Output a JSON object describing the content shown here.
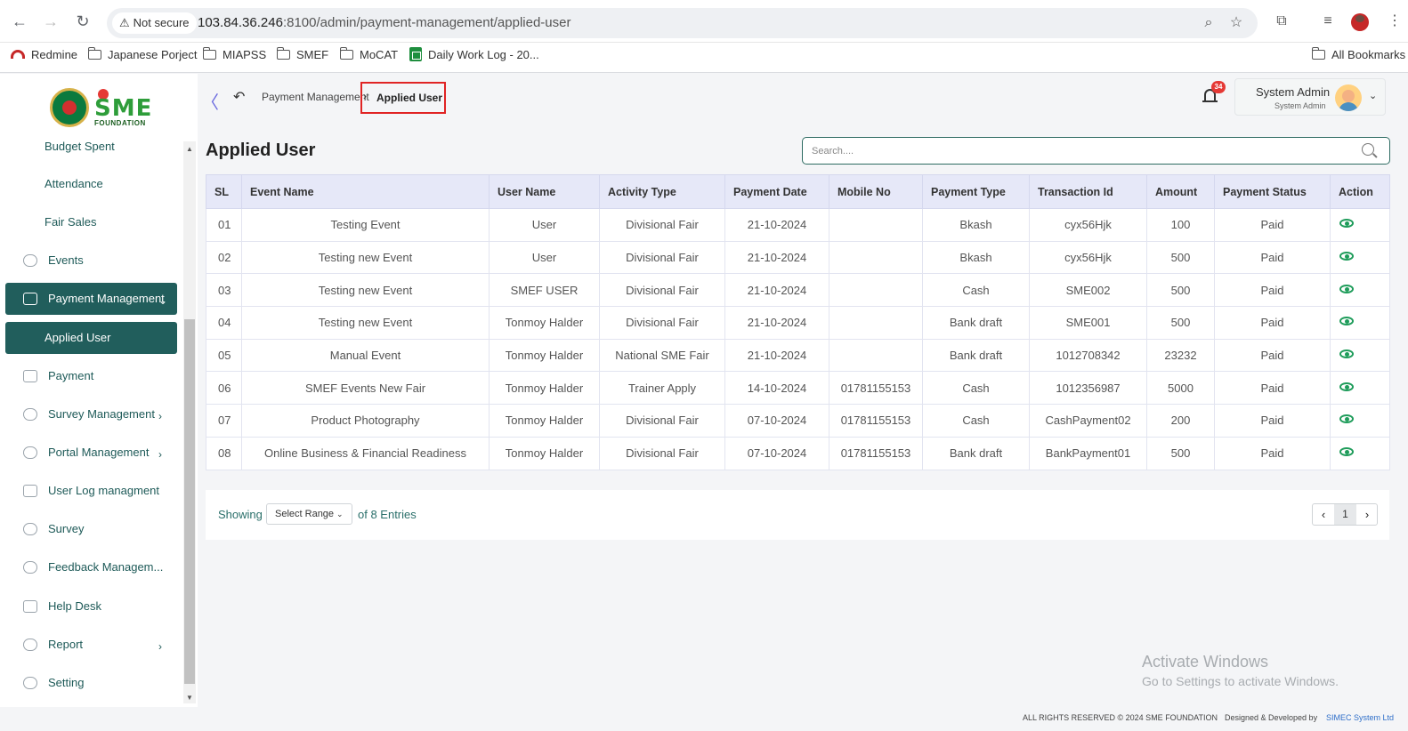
{
  "browser": {
    "not_secure_label": "Not secure",
    "url_host": "103.84.36.246",
    "url_rest": ":8100/admin/payment-management/applied-user",
    "bookmarks": [
      "Redmine",
      "Japanese Porject",
      "MIAPSS",
      "SMEF",
      "MoCAT",
      "Daily Work Log - 20...",
      "All Bookmarks"
    ]
  },
  "logo": {
    "brand": "SME",
    "sub": "FOUNDATION"
  },
  "sidebar": {
    "items": [
      {
        "label": "Budget Spent",
        "type": "sub"
      },
      {
        "label": "Attendance",
        "type": "sub"
      },
      {
        "label": "Fair Sales",
        "type": "sub"
      },
      {
        "label": "Events",
        "type": "item"
      },
      {
        "label": "Payment Management",
        "type": "item",
        "active": true
      },
      {
        "label": "Applied User",
        "type": "sub",
        "active": true
      },
      {
        "label": "Payment",
        "type": "item"
      },
      {
        "label": "Survey Management",
        "type": "item"
      },
      {
        "label": "Portal Management",
        "type": "item"
      },
      {
        "label": "User Log managment",
        "type": "item"
      },
      {
        "label": "Survey",
        "type": "item"
      },
      {
        "label": "Feedback Managem...",
        "type": "item"
      },
      {
        "label": "Help Desk",
        "type": "item"
      },
      {
        "label": "Report",
        "type": "item"
      },
      {
        "label": "Setting",
        "type": "item"
      }
    ]
  },
  "header": {
    "breadcrumb_parent": "Payment Management",
    "breadcrumb_current": "Applied User",
    "notification_count": "34",
    "user_name": "System Admin",
    "user_role": "System Admin"
  },
  "main": {
    "title": "Applied User",
    "search_placeholder": "Search....",
    "columns": [
      "SL",
      "Event Name",
      "User Name",
      "Activity Type",
      "Payment Date",
      "Mobile No",
      "Payment Type",
      "Transaction Id",
      "Amount",
      "Payment Status",
      "Action"
    ],
    "rows": [
      [
        "01",
        "Testing Event",
        "User",
        "Divisional Fair",
        "21-10-2024",
        "",
        "Bkash",
        "cyx56Hjk",
        "100",
        "Paid"
      ],
      [
        "02",
        "Testing new Event",
        "User",
        "Divisional Fair",
        "21-10-2024",
        "",
        "Bkash",
        "cyx56Hjk",
        "500",
        "Paid"
      ],
      [
        "03",
        "Testing new Event",
        "SMEF USER",
        "Divisional Fair",
        "21-10-2024",
        "",
        "Cash",
        "SME002",
        "500",
        "Paid"
      ],
      [
        "04",
        "Testing new Event",
        "Tonmoy Halder",
        "Divisional Fair",
        "21-10-2024",
        "",
        "Bank draft",
        "SME001",
        "500",
        "Paid"
      ],
      [
        "05",
        "Manual Event",
        "Tonmoy Halder",
        "National SME Fair",
        "21-10-2024",
        "",
        "Bank draft",
        "1012708342",
        "23232",
        "Paid"
      ],
      [
        "06",
        "SMEF Events New Fair",
        "Tonmoy Halder",
        "Trainer Apply",
        "14-10-2024",
        "01781155153",
        "Cash",
        "1012356987",
        "5000",
        "Paid"
      ],
      [
        "07",
        "Product Photography",
        "Tonmoy Halder",
        "Divisional Fair",
        "07-10-2024",
        "01781155153",
        "Cash",
        "CashPayment02",
        "200",
        "Paid"
      ],
      [
        "08",
        "Online Business & Financial Readiness",
        "Tonmoy Halder",
        "Divisional Fair",
        "07-10-2024",
        "01781155153",
        "Bank draft",
        "BankPayment01",
        "500",
        "Paid"
      ]
    ],
    "showing_label": "Showing",
    "range_label": "Select Range",
    "entries_label": "of 8 Entries",
    "current_page": "1"
  },
  "watermark": {
    "line1": "Activate Windows",
    "line2": "Go to Settings to activate Windows."
  },
  "footer": {
    "rights": "ALL RIGHTS RESERVED © 2024 SME FOUNDATION",
    "designed": "Designed & Developed by",
    "company": "SIMEC System Ltd"
  }
}
